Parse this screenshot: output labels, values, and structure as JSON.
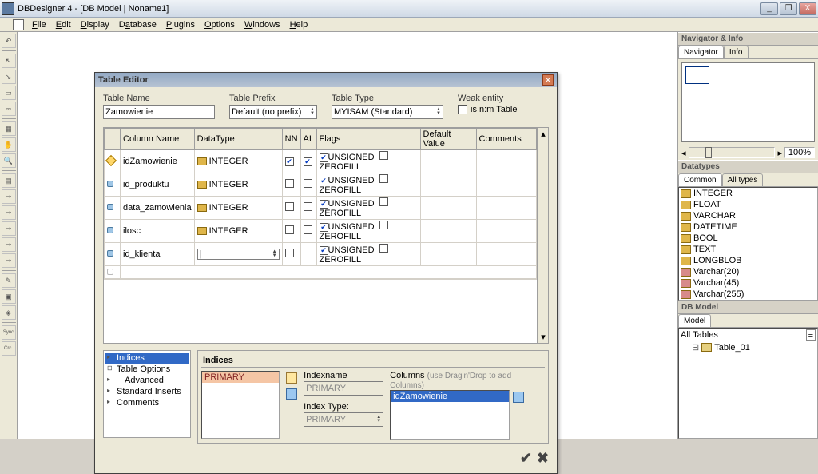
{
  "window": {
    "title": "DBDesigner 4 - [DB Model | Noname1]"
  },
  "menu": [
    "File",
    "Edit",
    "Display",
    "Database",
    "Plugins",
    "Options",
    "Windows",
    "Help"
  ],
  "dialog": {
    "title": "Table Editor",
    "table_name_lbl": "Table Name",
    "table_name": "Zamowienie",
    "prefix_lbl": "Table Prefix",
    "prefix": "Default (no prefix)",
    "type_lbl": "Table Type",
    "type": "MYISAM (Standard)",
    "weak_lbl": "Weak entity",
    "nm_lbl": "is n:m Table",
    "grid_hdrs": [
      "Column Name",
      "DataType",
      "NN",
      "AI",
      "Flags",
      "Default Value",
      "Comments"
    ],
    "rows": [
      {
        "key": true,
        "name": "idZamowienie",
        "type": "INTEGER",
        "nn": true,
        "ai": true,
        "unsigned": true,
        "zerofill": false,
        "editable": false
      },
      {
        "key": false,
        "name": "id_produktu",
        "type": "INTEGER",
        "nn": false,
        "ai": false,
        "unsigned": true,
        "zerofill": false,
        "editable": false
      },
      {
        "key": false,
        "name": "data_zamowienia",
        "type": "INTEGER",
        "nn": false,
        "ai": false,
        "unsigned": true,
        "zerofill": false,
        "editable": false
      },
      {
        "key": false,
        "name": "ilosc",
        "type": "INTEGER",
        "nn": false,
        "ai": false,
        "unsigned": true,
        "zerofill": false,
        "editable": false
      },
      {
        "key": false,
        "name": "id_klienta",
        "type": "",
        "nn": false,
        "ai": false,
        "unsigned": true,
        "zerofill": false,
        "editable": true
      }
    ],
    "flags_unsigned": "UNSIGNED",
    "flags_zerofill": "ZEROFILL",
    "tree": [
      "Indices",
      "Table Options",
      "Advanced",
      "Standard Inserts",
      "Comments"
    ],
    "indices_hdr": "Indices",
    "primary_item": "PRIMARY",
    "idxname_lbl": "Indexname",
    "idxname_val": "PRIMARY",
    "idxtype_lbl": "Index Type:",
    "idxtype_val": "PRIMARY",
    "cols_lbl": "Columns",
    "cols_hint": "(use Drag'n'Drop to add Columns)",
    "col_sel": "idZamowienie"
  },
  "nav": {
    "title": "Navigator & Info",
    "tabs": [
      "Navigator",
      "Info"
    ],
    "zoom": "100%"
  },
  "datatypes": {
    "title": "Datatypes",
    "tabs": [
      "Common",
      "All types"
    ],
    "items": [
      "INTEGER",
      "FLOAT",
      "VARCHAR",
      "DATETIME",
      "BOOL",
      "TEXT",
      "LONGBLOB",
      "Varchar(20)",
      "Varchar(45)",
      "Varchar(255)"
    ]
  },
  "dbmodel": {
    "title": "DB Model",
    "tab": "Model",
    "root": "All Tables",
    "table": "Table_01"
  }
}
